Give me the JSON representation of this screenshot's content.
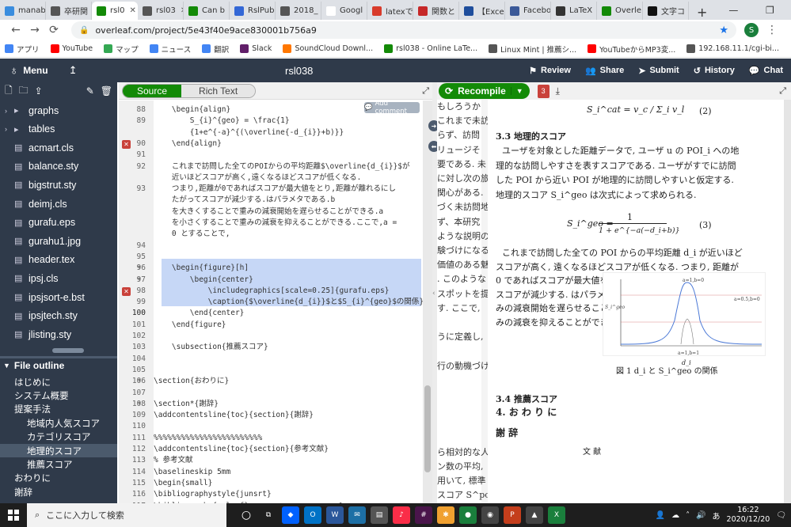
{
  "browser": {
    "tabs": [
      {
        "label": "manab",
        "color": "#3a8dde",
        "active": false
      },
      {
        "label": "卒研関",
        "color": "#555555",
        "active": false
      },
      {
        "label": "rsl0",
        "color": "#138a07",
        "active": true
      },
      {
        "label": "rsl03",
        "color": "#555555",
        "active": false
      },
      {
        "label": "Can b",
        "color": "#138a07",
        "active": false
      },
      {
        "label": "RslPub",
        "color": "#3367d6",
        "active": false
      },
      {
        "label": "2018_",
        "color": "#555555",
        "active": false
      },
      {
        "label": "Googl",
        "color": "#ffffff",
        "active": false
      },
      {
        "label": "latexで",
        "color": "#d83b2b",
        "active": false
      },
      {
        "label": "関数と",
        "color": "#c62828",
        "active": false
      },
      {
        "label": "【Excel",
        "color": "#1f4e9c",
        "active": false
      },
      {
        "label": "Facebo",
        "color": "#3b5998",
        "active": false
      },
      {
        "label": "LaTeX",
        "color": "#333333",
        "active": false
      },
      {
        "label": "Overle",
        "color": "#138a07",
        "active": false
      },
      {
        "label": "文字コ",
        "color": "#111111",
        "active": false
      }
    ],
    "new_tab": "+",
    "window_controls": [
      "—",
      "❐",
      "✕"
    ],
    "url": "overleaf.com/project/5e43f40e9ace830001b756a9",
    "profile_initial": "S",
    "bookmarks": [
      {
        "label": "アプリ",
        "color": "#4285f4"
      },
      {
        "label": "YouTube",
        "color": "#ff0000"
      },
      {
        "label": "マップ",
        "color": "#34a853"
      },
      {
        "label": "ニュース",
        "color": "#4285f4"
      },
      {
        "label": "翻訳",
        "color": "#4285f4"
      },
      {
        "label": "Slack",
        "color": "#611f69"
      },
      {
        "label": "SoundCloud Downl...",
        "color": "#ff7700"
      },
      {
        "label": "rsl038 - Online LaTe...",
        "color": "#138a07"
      },
      {
        "label": "Linux Mint | 推薦シ...",
        "color": "#555555"
      },
      {
        "label": "YouTubeからMP3変...",
        "color": "#ff0000"
      },
      {
        "label": "192.168.11.1/cgi-bi...",
        "color": "#555555"
      }
    ]
  },
  "overleaf": {
    "menu_label": "Menu",
    "project_title": "rsl038",
    "actions": [
      "Review",
      "Share",
      "Submit",
      "History",
      "Chat"
    ]
  },
  "files": [
    {
      "label": "graphs",
      "type": "folder"
    },
    {
      "label": "tables",
      "type": "folder"
    },
    {
      "label": "acmart.cls",
      "type": "file"
    },
    {
      "label": "balance.sty",
      "type": "file"
    },
    {
      "label": "bigstrut.sty",
      "type": "file"
    },
    {
      "label": "deimj.cls",
      "type": "file"
    },
    {
      "label": "gurafu.eps",
      "type": "file"
    },
    {
      "label": "gurahu1.jpg",
      "type": "file"
    },
    {
      "label": "header.tex",
      "type": "file"
    },
    {
      "label": "ipsj.cls",
      "type": "file"
    },
    {
      "label": "ipsjsort-e.bst",
      "type": "file"
    },
    {
      "label": "ipsjtech.sty",
      "type": "file"
    },
    {
      "label": "jlisting.sty",
      "type": "file"
    }
  ],
  "outline": {
    "title": "File outline",
    "items": [
      {
        "label": "はじめに",
        "level": 0,
        "selected": false
      },
      {
        "label": "システム概要",
        "level": 0,
        "selected": false
      },
      {
        "label": "提案手法",
        "level": 0,
        "selected": false
      },
      {
        "label": "地域内人気スコア",
        "level": 1,
        "selected": false
      },
      {
        "label": "カテゴリスコア",
        "level": 1,
        "selected": false
      },
      {
        "label": "地理的スコア",
        "level": 1,
        "selected": true
      },
      {
        "label": "推薦スコア",
        "level": 1,
        "selected": false
      },
      {
        "label": "おわりに",
        "level": 0,
        "selected": false
      },
      {
        "label": "謝辞",
        "level": 0,
        "selected": false
      }
    ]
  },
  "editor": {
    "source_label": "Source",
    "richtext_label": "Rich Text",
    "add_comment": "Add comment",
    "lines": [
      {
        "n": "88",
        "text": "    \\begin{align}",
        "err": false
      },
      {
        "n": "89",
        "text": "        S_{i}^{geo} = \\frac{1}",
        "err": false
      },
      {
        "n": "",
        "text": "        {1+e^{-a}^{(\\overline{-d_{i}}+b)}}",
        "err": false
      },
      {
        "n": "90",
        "text": "    \\end{align}",
        "err": true
      },
      {
        "n": "91",
        "text": "",
        "err": false
      },
      {
        "n": "92",
        "text": "    これまで訪問した全てのPOIからの平均距離$\\overline{d_{i}}$が",
        "err": false
      },
      {
        "n": "",
        "text": "    近いほどスコアが高く,遠くなるほどスコアが低くなる.",
        "err": false
      },
      {
        "n": "93",
        "text": "    つまり,距離が0であればスコアが最大値をとり,距離が離れるにし",
        "err": false
      },
      {
        "n": "",
        "text": "    たがってスコアが減少する.はパラメタである.b",
        "err": false
      },
      {
        "n": "",
        "text": "    を大きくすることで重みの減衰開始を遅らせることができる.a",
        "err": false
      },
      {
        "n": "",
        "text": "    を小さくすることで重みの減衰を抑えることができる.ここで,a =",
        "err": false
      },
      {
        "n": "",
        "text": "    0 とすることで,",
        "err": false
      },
      {
        "n": "94",
        "text": "",
        "err": false
      },
      {
        "n": "95",
        "text": "",
        "err": false
      },
      {
        "n": "96",
        "text": "    \\begin{figure}[h]",
        "err": false
      },
      {
        "n": "97",
        "text": "        \\begin{center}",
        "err": false
      },
      {
        "n": "98",
        "text": "            \\includegraphics[scale=0.25]{gurafu.eps}",
        "err": true
      },
      {
        "n": "99",
        "text": "            \\caption{$\\overline{d_{i}}$と$S_{i}^{geo}$の関係}",
        "err": false
      },
      {
        "n": "100",
        "text": "        \\end{center}",
        "err": false
      },
      {
        "n": "101",
        "text": "    \\end{figure}",
        "err": false
      },
      {
        "n": "102",
        "text": "",
        "err": false
      },
      {
        "n": "103",
        "text": "    \\subsection{推薦スコア}",
        "err": false
      },
      {
        "n": "104",
        "text": "",
        "err": false
      },
      {
        "n": "105",
        "text": "",
        "err": false
      },
      {
        "n": "106",
        "text": "\\section{おわりに}",
        "err": false
      },
      {
        "n": "107",
        "text": "",
        "err": false
      },
      {
        "n": "108",
        "text": "\\section*{謝辞}",
        "err": false
      },
      {
        "n": "109",
        "text": "\\addcontentsline{toc}{section}{謝辞}",
        "err": false
      },
      {
        "n": "110",
        "text": "",
        "err": false
      },
      {
        "n": "111",
        "text": "%%%%%%%%%%%%%%%%%%%%%%%%",
        "err": false
      },
      {
        "n": "112",
        "text": "\\addcontentsline{toc}{section}{参考文献}",
        "err": false
      },
      {
        "n": "113",
        "text": "% 参考文献",
        "err": false
      },
      {
        "n": "114",
        "text": "\\baselineskip 5mm",
        "err": false
      },
      {
        "n": "115",
        "text": "\\begin{small}",
        "err": false
      },
      {
        "n": "116",
        "text": "\\bibliographystyle{junsrt}",
        "err": false
      },
      {
        "n": "117",
        "text": "\\bibliography{rslref}                    %",
        "err": false
      }
    ]
  },
  "pdf": {
    "recompile_label": "Recompile",
    "logs_count": "3",
    "left_fragments": [
      "もしろうか",
      "これまで未訪",
      "らず、訪問",
      "リュージそ",
      "要である. 未",
      "に対し次の旅",
      "関心がある.",
      "づく未訪問地",
      "ず、本研究",
      "ような説明の",
      "験づけになる",
      "価値のある魅",
      ". このような",
      "スポットを提",
      "す. ここで,",
      "",
      "うに定義し,",
      "",
      "行の動機づけ",
      "",
      "",
      "",
      "",
      "",
      "ら相対的な人",
      "ン数の平均,",
      "用いて, 標準",
      "スコア S^pop"
    ],
    "eq2": "S_i^cat = v_c / Σ_i v_l",
    "eq2_num": "(2)",
    "sec33": "3.3  地理的スコア",
    "para1": [
      "ユーザを対象とした距離データで, ユーザ u の POI_i への地",
      "理的な訪問しやすさを表すスコアである. ユーザがすでに訪問",
      "した POI から近い POI が地理的に訪問しやすいと仮定する.",
      "地理的スコア S_i^geo は次式によって求められる."
    ],
    "eq3_lhs": "S_i^geo =",
    "eq3_num_top": "1",
    "eq3_den": "1 + e^{−a(−d_i+b)}",
    "eq3_num": "(3)",
    "para2": [
      "これまで訪問した全ての POI からの平均距離 d_i が近いほど",
      "スコアが高く, 遠くなるほどスコアが低くなる. つまり, 距離が",
      "0 であればスコアが最大値を",
      "スコアが減少する. はパラメ",
      "みの減衰開始を遅らせること",
      "みの減衰を抑えることができ"
    ],
    "fig_ylabel": "S_i^geo",
    "fig_xlabel": "d_i",
    "fig_ann": [
      "a=1,b=0",
      "a=0.5,b=0",
      "a=1,b=1"
    ],
    "fig_caption": "図 1  d_i と S_i^geo の関係",
    "sec34": "3.4  推薦スコア",
    "sec4": "4.  お わ り に",
    "ack": "謝        辞",
    "refs": "文        献"
  },
  "taskbar": {
    "search_placeholder": "ここに入力して検索",
    "time": "16:22",
    "date": "2020/12/20",
    "ime": "あ"
  }
}
